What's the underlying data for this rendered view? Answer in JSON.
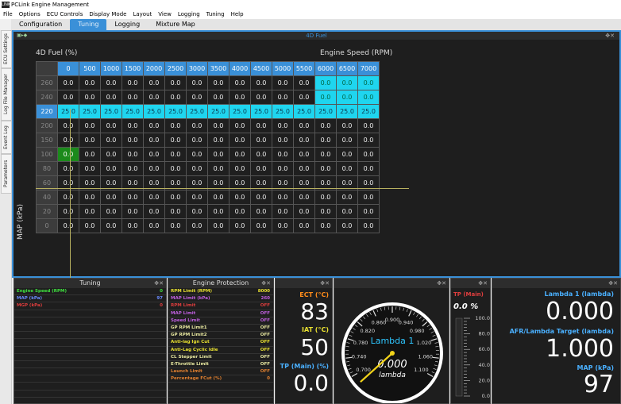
{
  "app": {
    "title": "PCLink Engine Management",
    "logo": "LINK"
  },
  "menu": [
    "File",
    "Options",
    "ECU Controls",
    "Display Mode",
    "Layout",
    "View",
    "Logging",
    "Tuning",
    "Help"
  ],
  "tabs": [
    "Configuration",
    "Tuning",
    "Logging",
    "Mixture Map"
  ],
  "active_tab": "Tuning",
  "sidebar_tabs": [
    "ECU Settings",
    "Log File Manager",
    "Event Log",
    "Parameters"
  ],
  "fuel_panel": {
    "title": "4D Fuel",
    "table_label": "4D Fuel (%)",
    "x_axis_label": "Engine Speed (RPM)",
    "y_axis_label": "MAP (kPa)",
    "rpm": [
      "0",
      "500",
      "1000",
      "1500",
      "2000",
      "2500",
      "3000",
      "3500",
      "4000",
      "4500",
      "5000",
      "5500",
      "6000",
      "6500",
      "7000"
    ],
    "rows": [
      {
        "kpa": "260",
        "cells": [
          "0.0",
          "0.0",
          "0.0",
          "0.0",
          "0.0",
          "0.0",
          "0.0",
          "0.0",
          "0.0",
          "0.0",
          "0.0",
          "0.0",
          "0.0",
          "0.0",
          "0.0"
        ]
      },
      {
        "kpa": "240",
        "cells": [
          "0.0",
          "0.0",
          "0.0",
          "0.0",
          "0.0",
          "0.0",
          "0.0",
          "0.0",
          "0.0",
          "0.0",
          "0.0",
          "0.0",
          "0.0",
          "0.0",
          "0.0"
        ]
      },
      {
        "kpa": "220",
        "cells": [
          "25.0",
          "25.0",
          "25.0",
          "25.0",
          "25.0",
          "25.0",
          "25.0",
          "25.0",
          "25.0",
          "25.0",
          "25.0",
          "25.0",
          "25.0",
          "25.0",
          "25.0"
        ]
      },
      {
        "kpa": "200",
        "cells": [
          "0.0",
          "0.0",
          "0.0",
          "0.0",
          "0.0",
          "0.0",
          "0.0",
          "0.0",
          "0.0",
          "0.0",
          "0.0",
          "0.0",
          "0.0",
          "0.0",
          "0.0"
        ]
      },
      {
        "kpa": "150",
        "cells": [
          "0.0",
          "0.0",
          "0.0",
          "0.0",
          "0.0",
          "0.0",
          "0.0",
          "0.0",
          "0.0",
          "0.0",
          "0.0",
          "0.0",
          "0.0",
          "0.0",
          "0.0"
        ]
      },
      {
        "kpa": "100",
        "cells": [
          "0.0",
          "0.0",
          "0.0",
          "0.0",
          "0.0",
          "0.0",
          "0.0",
          "0.0",
          "0.0",
          "0.0",
          "0.0",
          "0.0",
          "0.0",
          "0.0",
          "0.0"
        ]
      },
      {
        "kpa": "80",
        "cells": [
          "0.0",
          "0.0",
          "0.0",
          "0.0",
          "0.0",
          "0.0",
          "0.0",
          "0.0",
          "0.0",
          "0.0",
          "0.0",
          "0.0",
          "0.0",
          "0.0",
          "0.0"
        ]
      },
      {
        "kpa": "60",
        "cells": [
          "0.0",
          "0.0",
          "0.0",
          "0.0",
          "0.0",
          "0.0",
          "0.0",
          "0.0",
          "0.0",
          "0.0",
          "0.0",
          "0.0",
          "0.0",
          "0.0",
          "0.0"
        ]
      },
      {
        "kpa": "40",
        "cells": [
          "0.0",
          "0.0",
          "0.0",
          "0.0",
          "0.0",
          "0.0",
          "0.0",
          "0.0",
          "0.0",
          "0.0",
          "0.0",
          "0.0",
          "0.0",
          "0.0",
          "0.0"
        ]
      },
      {
        "kpa": "20",
        "cells": [
          "0.0",
          "0.0",
          "0.0",
          "0.0",
          "0.0",
          "0.0",
          "0.0",
          "0.0",
          "0.0",
          "0.0",
          "0.0",
          "0.0",
          "0.0",
          "0.0",
          "0.0"
        ]
      },
      {
        "kpa": "0",
        "cells": [
          "0.0",
          "0.0",
          "0.0",
          "0.0",
          "0.0",
          "0.0",
          "0.0",
          "0.0",
          "0.0",
          "0.0",
          "0.0",
          "0.0",
          "0.0",
          "0.0",
          "0.0"
        ]
      }
    ]
  },
  "tuning_panel": {
    "title": "Tuning",
    "rows": [
      {
        "label": "Engine Speed (RPM)",
        "value": "0",
        "color": "#3ee03e"
      },
      {
        "label": "MAP (kPa)",
        "value": "97",
        "color": "#6a8cff"
      },
      {
        "label": "MGP (kPa)",
        "value": "0",
        "color": "#e03e3e"
      }
    ]
  },
  "protection_panel": {
    "title": "Engine Protection",
    "rows": [
      {
        "label": "RPM Limit (RPM)",
        "value": "8000",
        "color": "#e8e030"
      },
      {
        "label": "MAP Limit (kPa)",
        "value": "260",
        "color": "#c060e0"
      },
      {
        "label": "RPM Limit",
        "value": "OFF",
        "color": "#e03e3e"
      },
      {
        "label": "MAP Limit",
        "value": "OFF",
        "color": "#c060e0"
      },
      {
        "label": "Speed Limit",
        "value": "OFF",
        "color": "#c060e0"
      },
      {
        "label": "GP RPM Limit1",
        "value": "OFF",
        "color": "#e8e8a0"
      },
      {
        "label": "GP RPM Limit2",
        "value": "OFF",
        "color": "#e8e8a0"
      },
      {
        "label": "Anti-lag Ign Cut",
        "value": "OFF",
        "color": "#e8e030"
      },
      {
        "label": "Anti-Lag Cyclic Idle",
        "value": "OFF",
        "color": "#e8e030"
      },
      {
        "label": "CL Stepper Limit",
        "value": "OFF",
        "color": "#e8e8a0"
      },
      {
        "label": "E-Throttle Limit",
        "value": "OFF",
        "color": "#e8e8a0"
      },
      {
        "label": "Launch Limit",
        "value": "OFF",
        "color": "#e08030"
      },
      {
        "label": "Percentage FCut (%)",
        "value": "0",
        "color": "#e08030"
      }
    ]
  },
  "gauges": {
    "ect": {
      "label": "ECT (°C)",
      "value": "83",
      "color": "#ff8c1a"
    },
    "iat": {
      "label": "IAT (°C)",
      "value": "50",
      "color": "#e8e030"
    },
    "tp": {
      "label": "TP (Main) (%)",
      "value": "0.0",
      "color": "#4ab0ff"
    },
    "lambda_dial": {
      "label": "Lambda 1",
      "value": "0.000",
      "unit": "lambda",
      "ticks": [
        "0.700",
        "0.740",
        "0.780",
        "0.820",
        "0.860",
        "0.900",
        "0.940",
        "0.980",
        "1.020",
        "1.060",
        "1.100"
      ],
      "value_num": 0.0
    },
    "tp_bar": {
      "label": "TP (Main)",
      "value": "0.0 %",
      "ticks": [
        "100.0",
        "80.0",
        "60.0",
        "40.0",
        "20.0",
        "0.0"
      ]
    },
    "lambda1": {
      "label": "Lambda 1 (lambda)",
      "value": "0.000",
      "color": "#4ab0ff"
    },
    "afr_target": {
      "label": "AFR/Lambda Target (lambda)",
      "value": "1.000",
      "color": "#4ab0ff"
    },
    "map": {
      "label": "MAP (kPa)",
      "value": "97",
      "color": "#4ab0ff"
    }
  }
}
